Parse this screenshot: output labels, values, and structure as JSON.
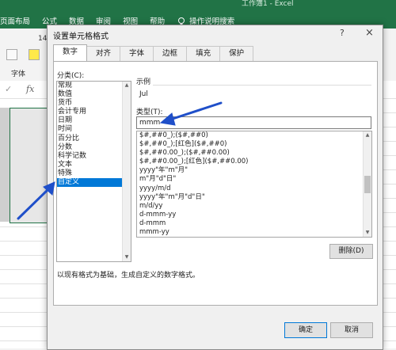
{
  "excel": {
    "window_title": "工作簿1 - Excel",
    "ribbon_tabs": [
      "页面布局",
      "公式",
      "数据",
      "审阅",
      "视图",
      "帮助",
      "操作说明搜索"
    ],
    "font_size": "14",
    "group_label_font": "字体",
    "accent": "#217346"
  },
  "dialog": {
    "title": "设置单元格格式",
    "help": "?",
    "close": "×",
    "tabs": [
      "数字",
      "对齐",
      "字体",
      "边框",
      "填充",
      "保护"
    ],
    "active_tab": "数字",
    "category_label": "分类(C):",
    "categories": [
      "常规",
      "数值",
      "货币",
      "会计专用",
      "日期",
      "时间",
      "百分比",
      "分数",
      "科学记数",
      "文本",
      "特殊",
      "自定义"
    ],
    "selected_category": "自定义",
    "sample_label": "示例",
    "sample_value": "Jul",
    "type_label": "类型(T):",
    "type_value": "mmm",
    "formats": [
      "$#,##0_);($#,##0)",
      "$#,##0_);[红色]($#,##0)",
      "$#,##0.00_);($#,##0.00)",
      "$#,##0.00_);[红色]($#,##0.00)",
      "yyyy\"年\"m\"月\"",
      "m\"月\"d\"日\"",
      "yyyy/m/d",
      "yyyy\"年\"m\"月\"d\"日\"",
      "m/d/yy",
      "d-mmm-yy",
      "d-mmm",
      "mmm-yy"
    ],
    "delete_button": "删除(D)",
    "description": "以现有格式为基础，生成自定义的数字格式。",
    "ok_button": "确定",
    "cancel_button": "取消",
    "selection_color": "#0078d7",
    "arrow_color": "#1f4fc9"
  }
}
